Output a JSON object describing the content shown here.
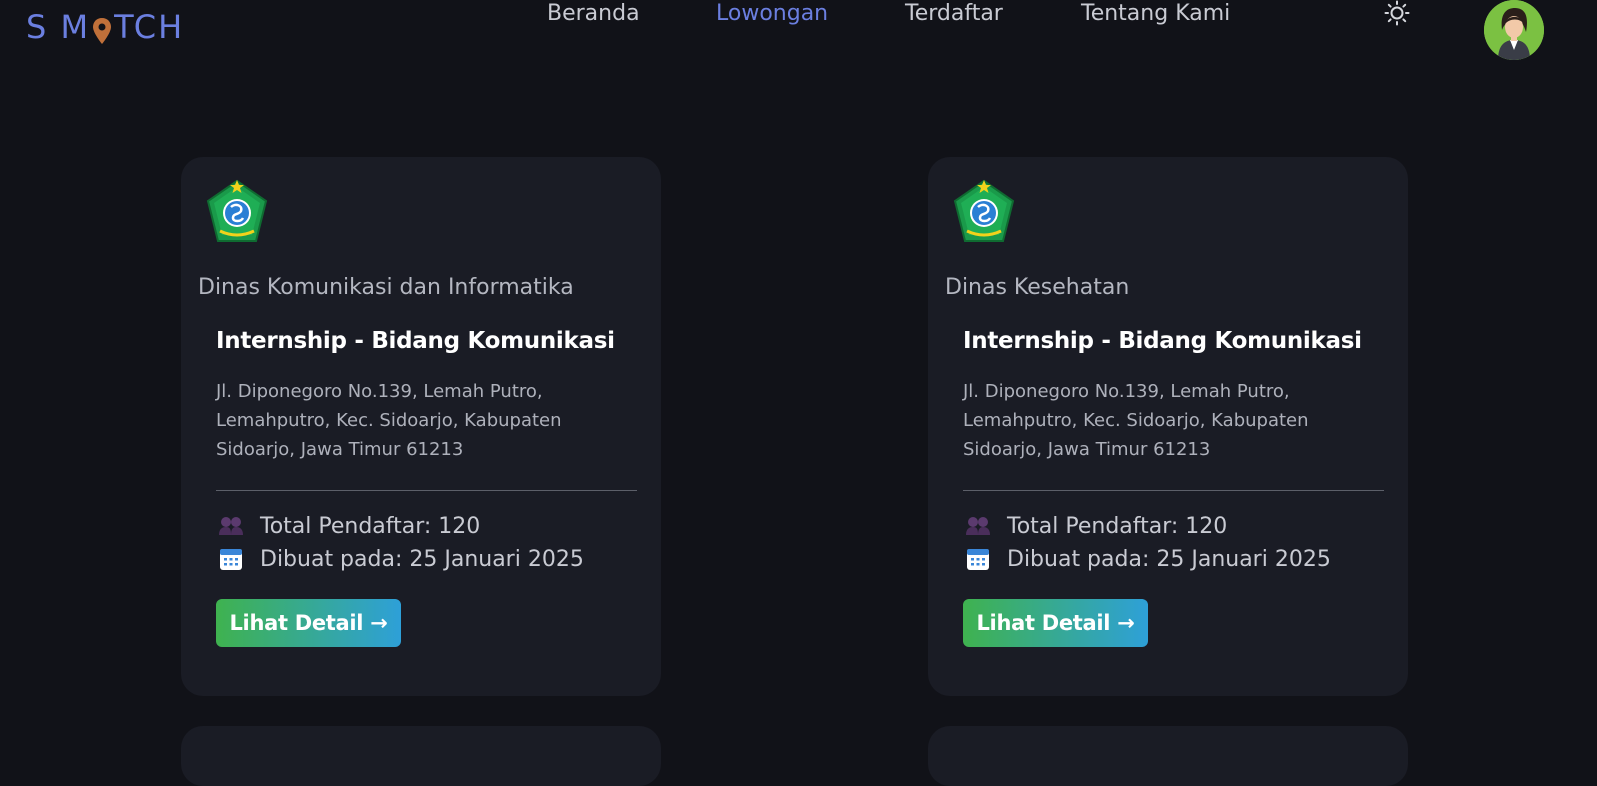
{
  "nav": {
    "logo": {
      "part1": "S M",
      "part2": "TCH"
    },
    "links": [
      {
        "label": "Beranda",
        "active": false
      },
      {
        "label": "Lowongan",
        "active": true
      },
      {
        "label": "Terdaftar",
        "active": false
      },
      {
        "label": "Tentang Kami",
        "active": false
      }
    ],
    "theme_icon": "sun-icon",
    "avatar_icon": "user-avatar-icon"
  },
  "colors": {
    "background": "#111218",
    "card": "#1a1c25",
    "accent": "#6b7fe0",
    "pin": "#c0703a",
    "button_start": "#3fb24f",
    "button_end": "#2ea0d8"
  },
  "cards": [
    {
      "department": "Dinas Komunikasi dan Informatika",
      "title": "Internship - Bidang Komunikasi",
      "address": "Jl. Diponegoro No.139, Lemah Putro, Lemahputro, Kec. Sidoarjo, Kabupaten Sidoarjo, Jawa Timur 61213",
      "applicants": "Total Pendaftar: 120",
      "created": "Dibuat pada: 25 Januari 2025",
      "button": "Lihat Detail →"
    },
    {
      "department": "Dinas Kesehatan",
      "title": "Internship - Bidang Komunikasi",
      "address": "Jl. Diponegoro No.139, Lemah Putro, Lemahputro, Kec. Sidoarjo, Kabupaten Sidoarjo, Jawa Timur 61213",
      "applicants": "Total Pendaftar: 120",
      "created": "Dibuat pada: 25 Januari 2025",
      "button": "Lihat Detail →"
    }
  ]
}
